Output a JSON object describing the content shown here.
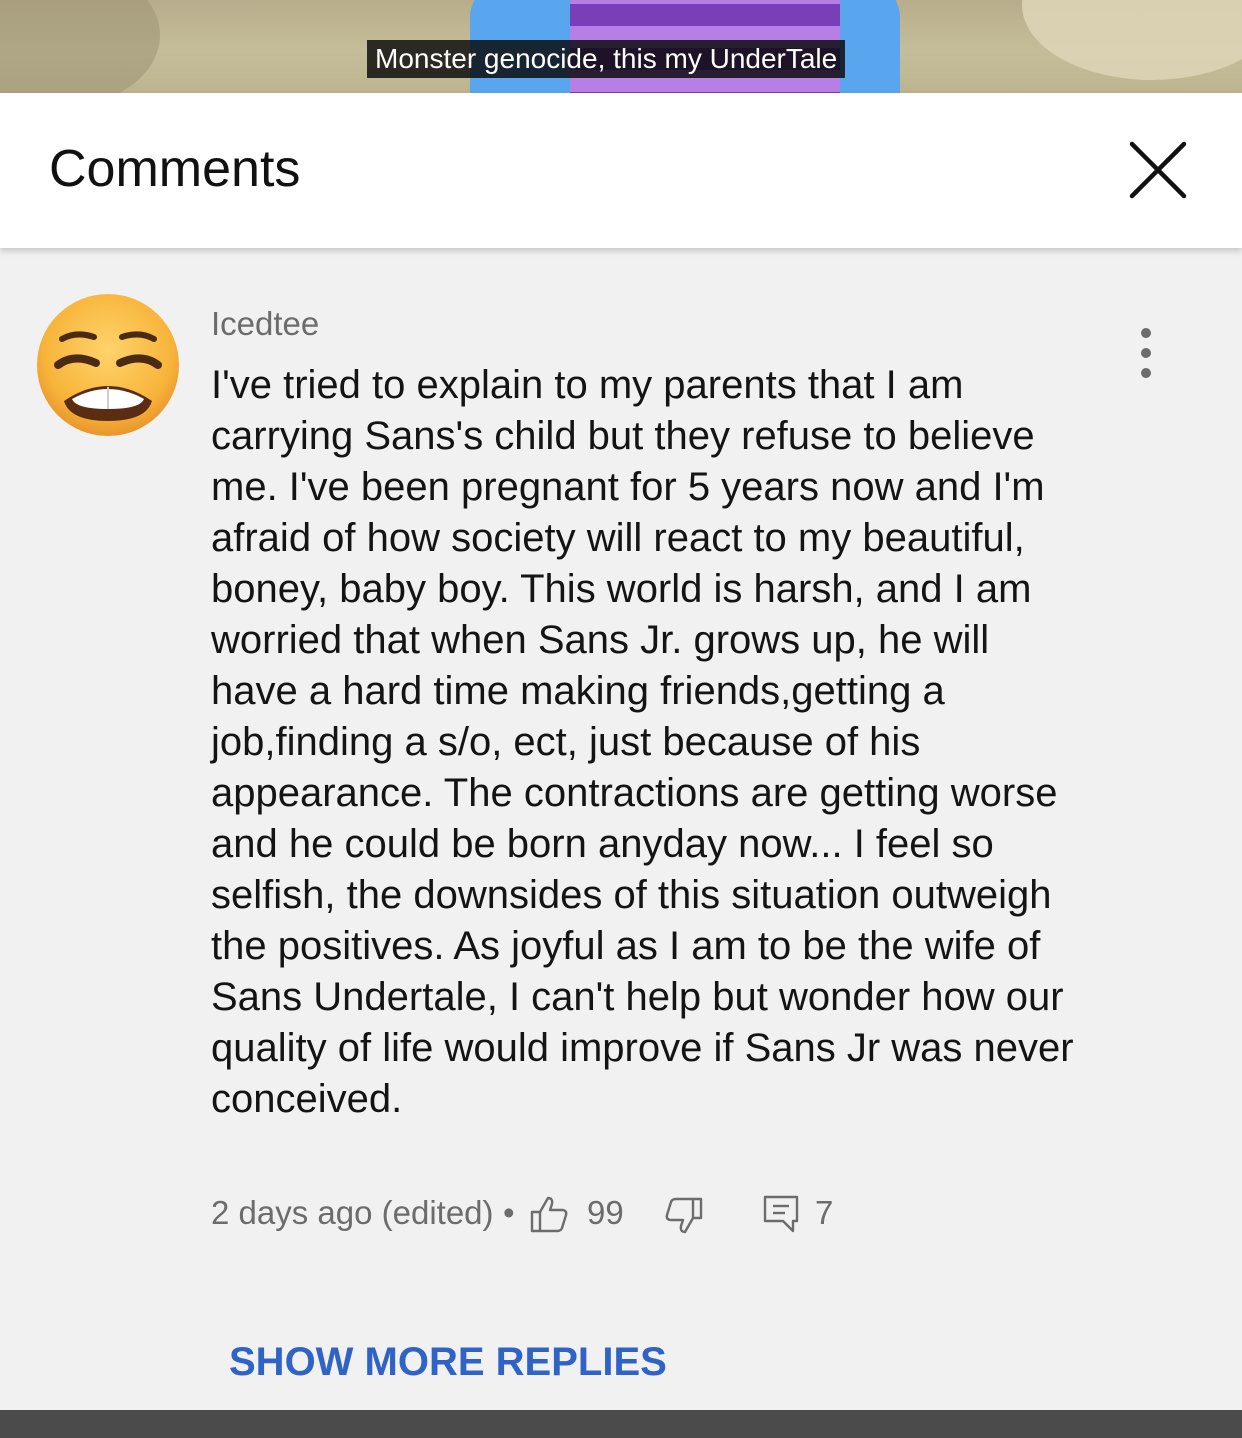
{
  "video": {
    "caption": "Monster genocide, this my UnderTale"
  },
  "panel": {
    "title": "Comments",
    "close_icon": "close-icon"
  },
  "comment": {
    "author": "Icedtee",
    "avatar_icon": "weary-face-emoji-icon",
    "text": "I've tried to explain to my parents that I am carrying Sans's child but they refuse to believe me. I've been pregnant for 5 years now and I'm afraid of how society will react to my beautiful, boney, baby boy. This world is harsh, and I am worried that when Sans Jr. grows up, he will have a hard time making friends,getting a job,finding a s/o, ect, just because of his appearance. The contractions are getting worse and he could be born anyday now... I feel so selfish, the downsides of this situation outweigh the positives. As joyful as I am to be the wife of Sans Undertale, I can't help but wonder how our quality of life would improve if Sans Jr was never conceived.",
    "timestamp": "2 days ago (edited)",
    "separator": "•",
    "likes": "99",
    "replies": "7",
    "icons": {
      "more": "more-vert-icon",
      "like": "thumbs-up-icon",
      "dislike": "thumbs-down-icon",
      "reply": "reply-comment-icon"
    }
  },
  "actions": {
    "show_more_replies": "SHOW MORE REPLIES"
  },
  "colors": {
    "link": "#2f64c6",
    "background": "#f1f1f1",
    "header": "#ffffff",
    "secondary_text": "#6c6c6c"
  }
}
